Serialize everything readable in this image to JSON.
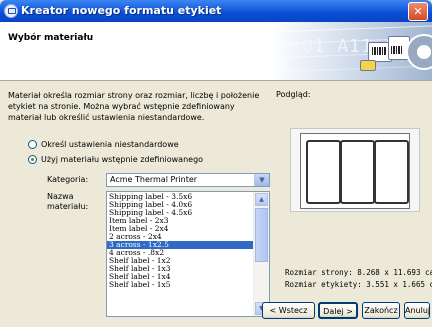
{
  "window": {
    "title": "Kreator nowego formatu etykiet",
    "close_symbol": "✕"
  },
  "header": {
    "title": "Wybór materiału",
    "art_text": "/01 A11 0"
  },
  "description": "Materiał określa rozmiar strony oraz rozmiar, liczbę i położenie etykiet na stronie. Można wybrać wstępnie zdefiniowany materiał lub określić ustawienia niestandardowe.",
  "preview_label": "Podgląd:",
  "options": {
    "custom": "Określ ustawienia niestandardowe",
    "predefined": "Użyj materiału wstępnie zdefiniowanego",
    "selected": "predefined"
  },
  "fields": {
    "category_label": "Kategoria:",
    "category_value": "Acme Thermal Printer",
    "material_label_line1": "Nazwa",
    "material_label_line2": "materiału:"
  },
  "materials": [
    "Shipping label - 3.5x6",
    "Shipping label - 4.0x6",
    "Shipping label - 4.5x6",
    "Item label - 2x3",
    "Item label - 2x4",
    "2 across - 2x4",
    "3 across - 1x2.5",
    "4 across - .8x2",
    "Shelf label - 1x2",
    "Shelf label - 1x3",
    "Shelf label - 1x4",
    "Shelf label - 1x5"
  ],
  "selected_material_index": 6,
  "preview": {
    "labels_across": 3
  },
  "sizes": {
    "page": "Rozmiar strony: 8.268 x 11.693 cal",
    "label": "Rozmiar etykiety: 3.551 x 1.665 cal"
  },
  "buttons": {
    "back": "< Wstecz",
    "next": "Dalej >",
    "finish": "Zakończ",
    "cancel": "Anuluj"
  }
}
